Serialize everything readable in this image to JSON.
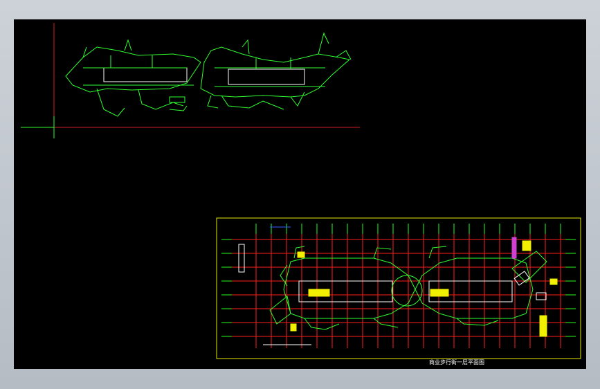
{
  "drawing": {
    "caption": "商业步行街一层平面图",
    "background_color": "#000000",
    "frame_color": "#e8e800",
    "grid_color_red": "#ff2020",
    "grid_color_green": "#20ff20",
    "linework_color": "#30ff30"
  }
}
